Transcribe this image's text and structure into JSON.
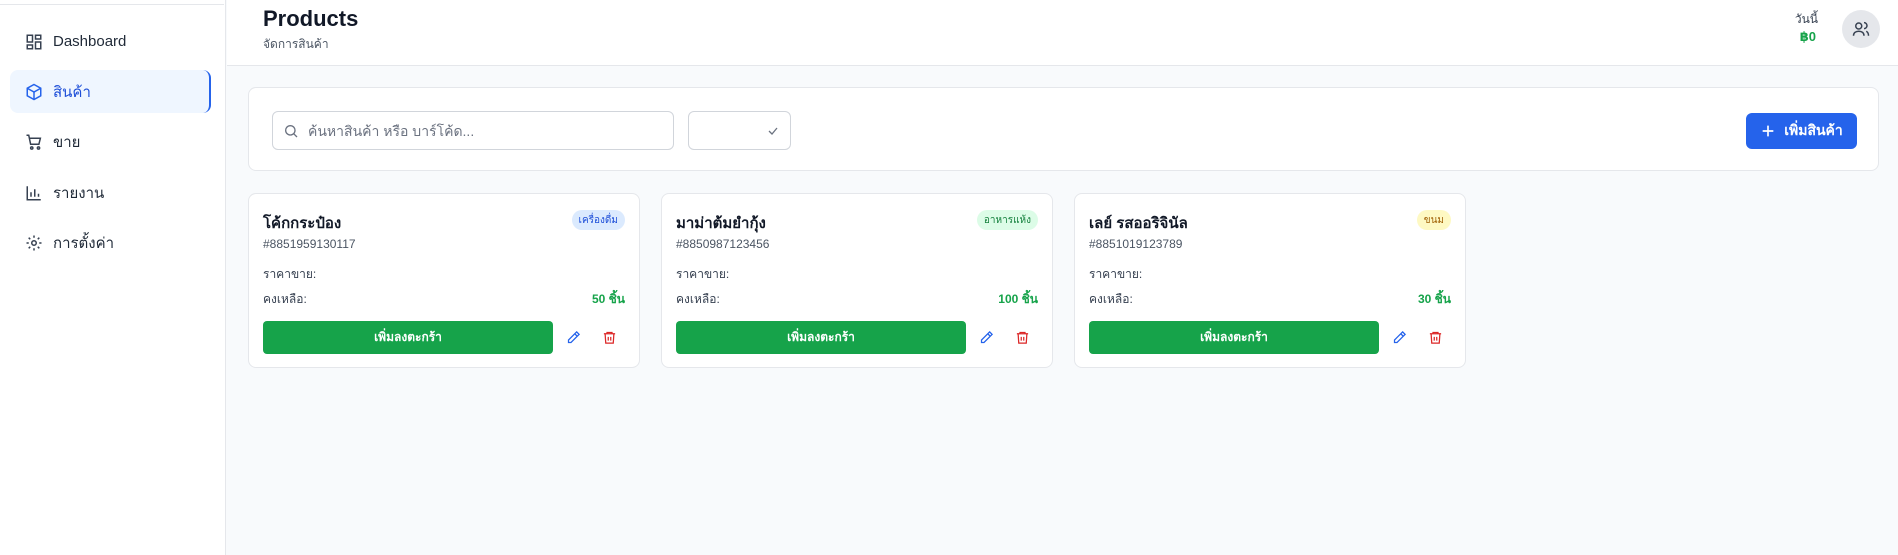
{
  "sidebar": {
    "items": [
      {
        "label": "Dashboard",
        "icon": "dashboard-grid-icon"
      },
      {
        "label": "สินค้า",
        "icon": "package-box-icon",
        "active": true
      },
      {
        "label": "ขาย",
        "icon": "shopping-cart-icon"
      },
      {
        "label": "รายงาน",
        "icon": "bar-chart-icon"
      },
      {
        "label": "การตั้งค่า",
        "icon": "gear-icon"
      }
    ]
  },
  "header": {
    "title": "Products",
    "subtitle": "จัดการสินค้า",
    "today_label": "วันนี้",
    "today_value": "฿0",
    "avatar_icon": "users-icon"
  },
  "toolbar": {
    "search_placeholder": "ค้นหาสินค้า หรือ บาร์โค้ด...",
    "search_value": "",
    "category_selected": "",
    "add_label": "เพิ่มสินค้า"
  },
  "products": [
    {
      "name": "โค้กกระป๋อง",
      "code": "#8851959130117",
      "category": "เครื่องดื่ม",
      "price_label": "ราคาขาย:",
      "price_value": "",
      "stock_label": "คงเหลือ:",
      "stock_value": "50 ชิ้น",
      "cart_label": "เพิ่มลงตะกร้า"
    },
    {
      "name": "มาม่าต้มยำกุ้ง",
      "code": "#8850987123456",
      "category": "อาหารแห้ง",
      "price_label": "ราคาขาย:",
      "price_value": "",
      "stock_label": "คงเหลือ:",
      "stock_value": "100 ชิ้น",
      "cart_label": "เพิ่มลงตะกร้า"
    },
    {
      "name": "เลย์ รสออริจินัล",
      "code": "#8851019123789",
      "category": "ขนม",
      "price_label": "ราคาขาย:",
      "price_value": "",
      "stock_label": "คงเหลือ:",
      "stock_value": "30 ชิ้น",
      "cart_label": "เพิ่มลงตะกร้า"
    }
  ],
  "colors": {
    "primary": "#2563eb",
    "success": "#16a34a",
    "danger": "#dc2626",
    "badge_drink_bg": "#dbeafe",
    "badge_drink_fg": "#1d4ed8",
    "badge_dry_bg": "#dcfce7",
    "badge_dry_fg": "#15803d",
    "badge_snack_bg": "#fef9c3",
    "badge_snack_fg": "#a16207"
  }
}
